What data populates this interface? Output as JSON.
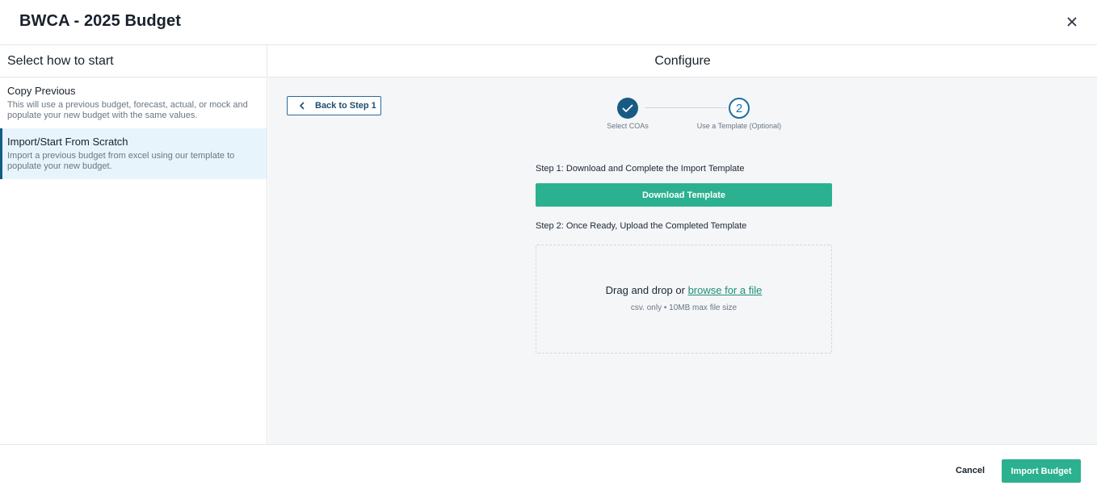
{
  "header": {
    "title": "BWCA - 2025 Budget",
    "close_icon": "close-icon"
  },
  "sidebar": {
    "heading": "Select how to start",
    "options": [
      {
        "title": "Copy Previous",
        "description": "This will use a previous budget, forecast, actual, or mock and populate your new budget with the same values.",
        "selected": false
      },
      {
        "title": "Import/Start From Scratch",
        "description": "Import a previous budget from excel using our template to populate your new budget.",
        "selected": true
      }
    ]
  },
  "main": {
    "heading": "Configure",
    "back_button": {
      "label": "Back to Step 1",
      "icon": "chevron-left-icon"
    },
    "stepper": {
      "steps": [
        {
          "label": "Select COAs",
          "status": "complete",
          "icon": "check-icon"
        },
        {
          "number": "2",
          "label": "Use a Template (Optional)",
          "status": "current"
        }
      ]
    },
    "step1_text": "Step 1: Download and Complete the Import Template",
    "download_button": "Download Template",
    "step2_text": "Step 2: Once Ready, Upload the Completed Template",
    "dropzone": {
      "prefix": "Drag and drop or ",
      "link": "browse for a file",
      "hint": "csv. only • 10MB max file size"
    }
  },
  "footer": {
    "cancel": "Cancel",
    "import": "Import Budget"
  },
  "colors": {
    "primary_green": "#2bb18f",
    "primary_blue": "#175b84",
    "selected_bg": "#e8f4fb",
    "panel_bg": "#f4f6f8"
  }
}
